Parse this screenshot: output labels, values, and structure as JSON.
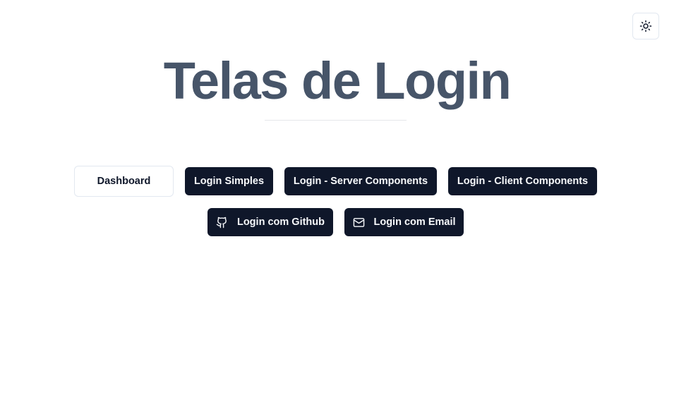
{
  "header": {
    "theme_toggle_icon": "sun-icon"
  },
  "main": {
    "title": "Telas de Login",
    "buttons": {
      "dashboard": "Dashboard",
      "login_simples": "Login Simples",
      "login_server": "Login - Server Components",
      "login_client": "Login - Client Components",
      "login_github": "Login com Github",
      "login_email": "Login com Email"
    },
    "icons": {
      "github": "github-icon",
      "email": "mail-icon"
    }
  },
  "colors": {
    "title": "#475569",
    "button_dark": "#0f172a",
    "button_text_light": "#f8fafc",
    "border": "#e2e8f0"
  }
}
